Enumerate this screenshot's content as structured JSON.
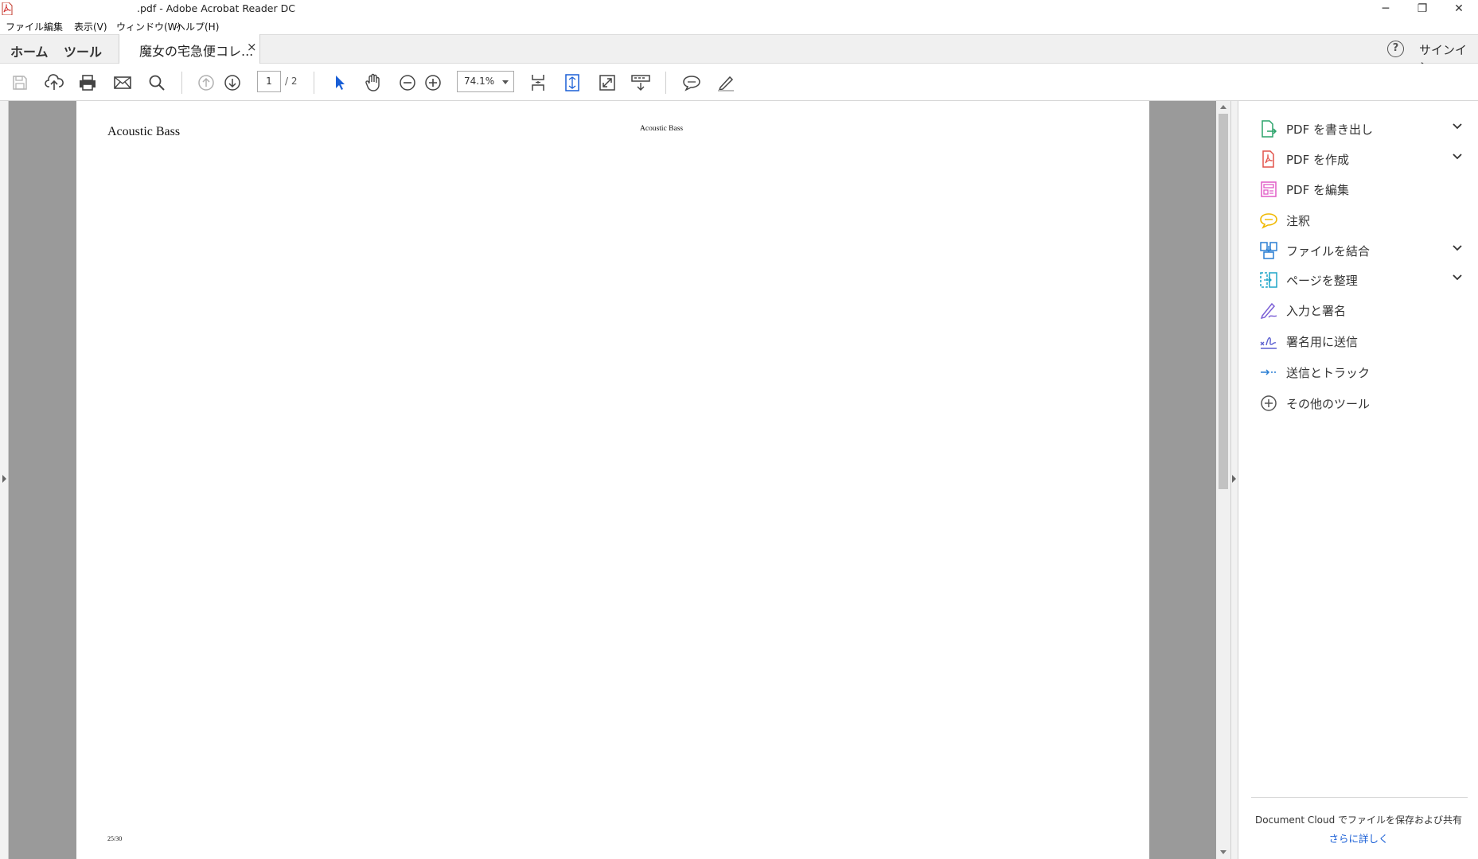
{
  "window": {
    "title": ".pdf - Adobe Acrobat Reader DC",
    "minimize": "─",
    "restore": "❐",
    "close": "✕"
  },
  "menu": [
    "ファイル",
    "編集",
    "表示(V)",
    "ウィンドウ(W)",
    "ヘルプ(H)"
  ],
  "tabs": {
    "home": "ホーム",
    "tools": "ツール",
    "document": "魔女の宅急便コレ...",
    "close": "×",
    "help": "?",
    "signin": "サインイン"
  },
  "toolbar": {
    "page_current": "1",
    "page_total": "/ 2",
    "zoom": "74.1%",
    "icons": [
      "save-icon",
      "upload-icon",
      "print-icon",
      "email-icon",
      "search-icon",
      "previous-page-icon",
      "next-page-icon",
      "select-cursor-icon",
      "hand-icon",
      "zoom-out-icon",
      "zoom-in-icon",
      "scroll-mode-icon",
      "fit-page-icon",
      "full-screen-icon",
      "read-mode-icon",
      "comment-icon",
      "highlight-pen-icon"
    ]
  },
  "document": {
    "heading": "Acoustic Bass",
    "header_center": "Acoustic Bass",
    "footer": "25/30"
  },
  "tools_pane": {
    "items": [
      {
        "label": "PDF を書き出し",
        "icon": "export-pdf-icon",
        "color": "#2ba36b",
        "expandable": true
      },
      {
        "label": "PDF を作成",
        "icon": "create-pdf-icon",
        "color": "#e2534b",
        "expandable": true
      },
      {
        "label": "PDF を編集",
        "icon": "edit-pdf-icon",
        "color": "#e05bc6",
        "expandable": false
      },
      {
        "label": "注釈",
        "icon": "comment-icon",
        "color": "#f0b800",
        "expandable": false
      },
      {
        "label": "ファイルを結合",
        "icon": "combine-files-icon",
        "color": "#2a7fd4",
        "expandable": true
      },
      {
        "label": "ページを整理",
        "icon": "organize-pages-icon",
        "color": "#1fa5c9",
        "expandable": true
      },
      {
        "label": "入力と署名",
        "icon": "fill-sign-icon",
        "color": "#7b5fd6",
        "expandable": false
      },
      {
        "label": "署名用に送信",
        "icon": "send-for-signature-icon",
        "color": "#5a5fd0",
        "expandable": false
      },
      {
        "label": "送信とトラック",
        "icon": "send-track-icon",
        "color": "#2a7fd4",
        "expandable": false
      },
      {
        "label": "その他のツール",
        "icon": "more-tools-icon",
        "color": "#555555",
        "expandable": false
      }
    ],
    "cloud_text": "Document Cloud でファイルを保存および共有",
    "learn_more": "さらに詳しく"
  }
}
